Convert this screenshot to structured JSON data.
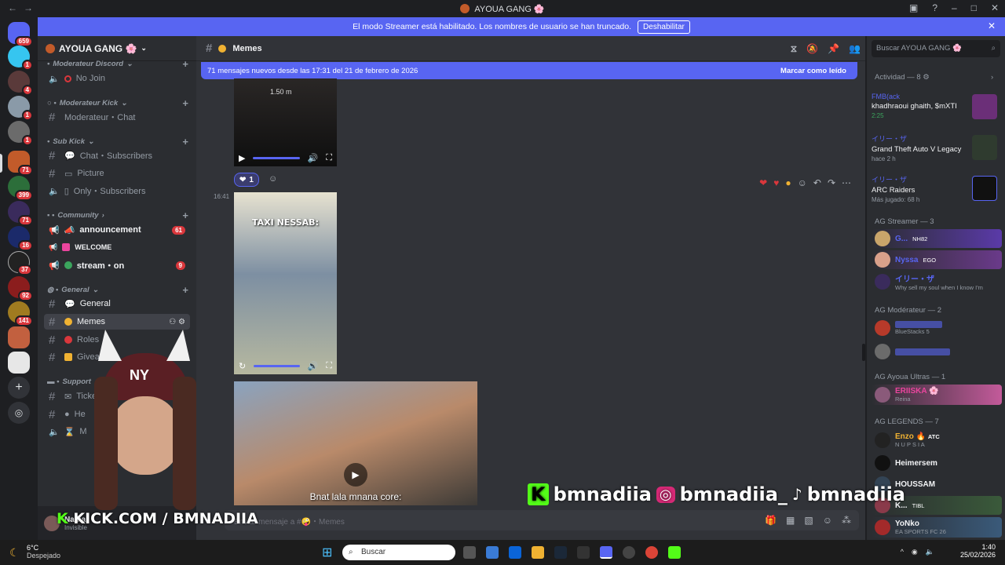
{
  "window": {
    "title": "AYOUA GANG 🌸"
  },
  "banner": {
    "text": "El modo Streamer está habilitado. Los nombres de usuario se han truncado.",
    "button": "Deshabilitar"
  },
  "server_badges": [
    "659",
    "1",
    "4",
    "1",
    "1",
    "71",
    "399",
    "71",
    "16",
    "37",
    "92",
    "141"
  ],
  "server": {
    "name": "AYOUA GANG 🌸"
  },
  "categories": {
    "mod_discord": "Moderateur Discord",
    "mod_kick": "Moderateur Kick",
    "sub_kick": "Sub Kick",
    "community": "Community",
    "general": "General",
    "support": "Support"
  },
  "channels": {
    "no_join": "No Join",
    "moderateur_chat": "Moderateur・Chat",
    "chat_subs": "Chat・Subscribers",
    "picture": "Picture",
    "only_subs": "Only・Subscribers",
    "announcement": "announcement",
    "announcement_badge": "61",
    "welcome": "WELCOME",
    "stream_on": "stream・on",
    "stream_badge": "9",
    "general": "General",
    "memes": "Memes",
    "roles": "Roles",
    "giveaway": "Giveaw",
    "ticket": "Ticket",
    "help": "He",
    "misc": "M"
  },
  "user": {
    "name": "Nadia",
    "status": "Invisible"
  },
  "channel_header": {
    "name": "Memes"
  },
  "new_messages": {
    "text": "71 mensajes nuevos desde las 17:31 del 21 de febrero de 2026",
    "action": "Marcar como leído"
  },
  "message": {
    "time": "16:41",
    "reaction_count": "1"
  },
  "video1": {
    "caption": "TAXI NESSAB:"
  },
  "video2": {
    "caption": "Bnat lala mnana core:"
  },
  "video0": {
    "text": "1.50 m"
  },
  "composer": {
    "placeholder": "Enviar mensaje a #🤪・Memes"
  },
  "members": {
    "search": "Buscar AYOUA GANG 🌸",
    "activity_label": "Actividad — 8",
    "activities": [
      {
        "who": "FMB(ack",
        "what": "khadhraoui ghaith, $mXTI",
        "sub": "2:25"
      },
      {
        "who": "イリー・ザ",
        "what": "Grand Theft Auto V Legacy",
        "sub": "hace 2 h"
      },
      {
        "who": "イリー・ザ",
        "what": "ARC Raiders",
        "sub": "Más jugado: 68 h"
      }
    ],
    "groups": [
      {
        "label": "AG Streamer — 3"
      },
      {
        "label": "AG Modérateur — 2"
      },
      {
        "label": "AG Ayoua Ultras — 1"
      },
      {
        "label": "AG LEGENDS — 7"
      }
    ],
    "list": [
      {
        "name": "G...",
        "tag": "NH82",
        "sub": ""
      },
      {
        "name": "Nyssa",
        "tag": "EGO",
        "sub": ""
      },
      {
        "name": "イリー・ザ",
        "tag": "",
        "sub": "Why sell my soul when I know I'm"
      },
      {
        "name": "",
        "tag": "",
        "sub": "BlueStacks 5"
      },
      {
        "name": "",
        "tag": "",
        "sub": ""
      },
      {
        "name": "ERIISKA 🌸",
        "tag": "",
        "sub": "Reina"
      },
      {
        "name": "Enzo 🔥",
        "tag": "ATC",
        "sub": "N U P S I A"
      },
      {
        "name": "Heimersem",
        "tag": "",
        "sub": ""
      },
      {
        "name": "HOUSSAM",
        "tag": "",
        "sub": ""
      },
      {
        "name": "K...",
        "tag": "TIBL",
        "sub": ""
      },
      {
        "name": "YoNko",
        "tag": "",
        "sub": "EA SPORTS FC 26"
      }
    ]
  },
  "overlay": {
    "kick": "KICK.COM / BMNADIIA",
    "handle1": "bmnadiia",
    "handle2": "bmnadiia_",
    "handle3": "bmnadiia",
    "cap_text": "NY"
  },
  "taskbar": {
    "weather_temp": "6°C",
    "weather_desc": "Despejado",
    "search": "Buscar",
    "time": "1:40",
    "date": "25/02/2026"
  },
  "colors": {
    "blurple": "#5865f2",
    "red": "#da373c",
    "bg": "#313338"
  }
}
